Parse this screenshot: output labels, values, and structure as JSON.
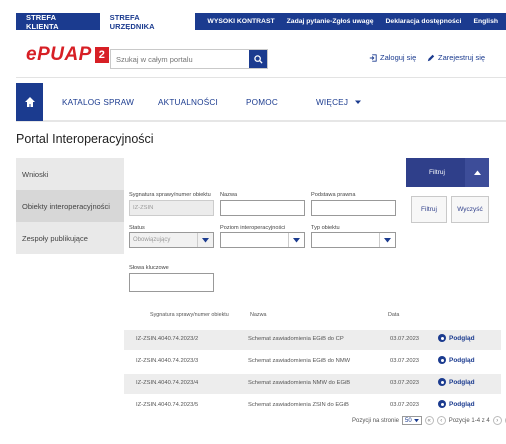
{
  "topbar": {
    "zone_citizen": "STREFA KLIENTA",
    "zone_clerk": "STREFA URZĘDNIKA",
    "contrast": "WYSOKI KONTRAST",
    "ask": "Zadaj pytanie-Zgłoś uwagę",
    "accessibility": "Deklaracja dostępności",
    "english": "English"
  },
  "header": {
    "logo_text": "ePUAP",
    "logo_num": "2",
    "search_placeholder": "Szukaj w całym portalu",
    "login": "Zaloguj się",
    "register": "Zarejestruj się",
    "icons": {
      "search": "search-icon",
      "login": "login-icon",
      "register": "pen-icon"
    }
  },
  "nav": {
    "home_icon": "home-icon",
    "items": [
      "KATALOG SPRAW",
      "AKTUALNOŚCI",
      "POMOC",
      "WIĘCEJ"
    ]
  },
  "page": {
    "title": "Portal Interoperacyjności"
  },
  "sidebar": {
    "items": [
      {
        "label": "Wnioski",
        "active": false
      },
      {
        "label": "Obiekty interoperacyjności",
        "active": true
      },
      {
        "label": "Zespoły publikujące",
        "active": false
      }
    ]
  },
  "filters": {
    "signature_label": "Sygnatura sprawy/numer obiektu",
    "signature_value": "IZ-ZSIN",
    "name_label": "Nazwa",
    "legal_label": "Podstawa prawna",
    "status_label": "Status",
    "status_value": "Obowiązujący",
    "level_label": "Poziom interoperacyjności",
    "type_label": "Typ obiektu",
    "keywords_label": "Słowa kluczowe"
  },
  "buttons": {
    "filter_main": "Filtruj",
    "filter": "Filtruj",
    "clear": "Wyczyść"
  },
  "table": {
    "headers": [
      "Sygnatura sprawy/numer obiektu",
      "Nazwa",
      "Data"
    ],
    "view_label": "Podgląd",
    "rows": [
      {
        "signature": "IZ-ZSIN.4040.74.2023/2",
        "name": "Schemat zawiadomienia EGiB do CP",
        "date": "03.07.2023"
      },
      {
        "signature": "IZ-ZSIN.4040.74.2023/3",
        "name": "Schemat zawiadomienia EGiB do NMW",
        "date": "03.07.2023"
      },
      {
        "signature": "IZ-ZSIN.4040.74.2023/4",
        "name": "Schemat zawiadomienia NMW do EGiB",
        "date": "03.07.2023"
      },
      {
        "signature": "IZ-ZSIN.4040.74.2023/5",
        "name": "Schemat zawiadomienia ZSIN do EGiB",
        "date": "03.07.2023"
      }
    ]
  },
  "pager": {
    "per_page_label": "Pozycji na stronie",
    "per_page": "50",
    "range": "Pozycje 1-4 z 4"
  },
  "colors": {
    "brand_blue": "#1b3b8f",
    "logo_red": "#d71f25",
    "button_blue": "#2f3f8a"
  }
}
